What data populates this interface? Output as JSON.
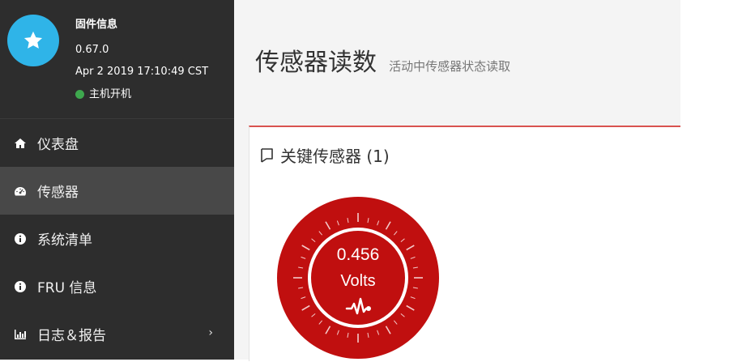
{
  "profile": {
    "title": "固件信息",
    "version": "0.67.0",
    "build_date": "Apr 2 2019 17:10:49 CST",
    "host_status": "主机开机",
    "avatar_icon": "star-icon",
    "avatar_color": "#2fb4e8",
    "status_color": "#3ea84e"
  },
  "nav": {
    "items": [
      {
        "label": "仪表盘",
        "icon": "home-icon"
      },
      {
        "label": "传感器",
        "icon": "dashboard-icon",
        "active": true
      },
      {
        "label": "系统清单",
        "icon": "info-icon"
      },
      {
        "label": "FRU 信息",
        "icon": "info-icon"
      },
      {
        "label": "日志＆报告",
        "icon": "bar-chart-icon",
        "chevron": "chevron-right-icon"
      }
    ]
  },
  "page": {
    "title": "传感器读数",
    "subtitle": "活动中传感器状态读取"
  },
  "panel": {
    "title": "关键传感器 (1)",
    "title_icon": "flag-icon",
    "accent_color": "#d9534f"
  },
  "sensor": {
    "value": "0.456",
    "unit": "Volts",
    "icon": "heartbeat-icon",
    "color": "#c00f0f"
  }
}
